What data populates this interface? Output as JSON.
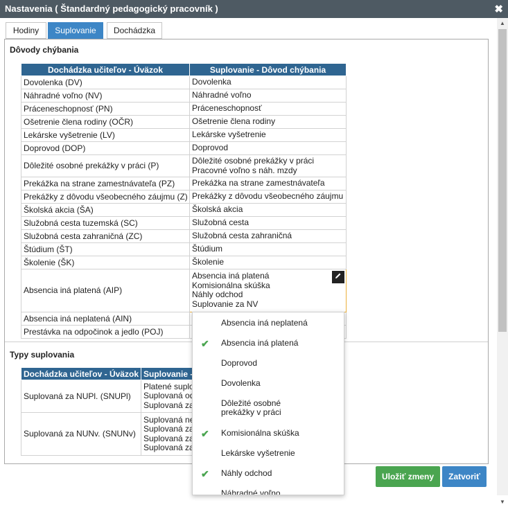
{
  "window": {
    "title": "Nastavenia ( Štandardný pedagogický pracovník )",
    "close_glyph": "✖"
  },
  "tabs": [
    {
      "label": "Hodiny",
      "active": false
    },
    {
      "label": "Suplovanie",
      "active": true
    },
    {
      "label": "Dochádzka",
      "active": false
    }
  ],
  "reasons": {
    "title": "Dôvody chýbania",
    "columns": [
      "Dochádzka učiteľov - Úväzok",
      "Suplovanie - Dôvod chýbania"
    ],
    "rows": [
      {
        "a": "Dovolenka (DV)",
        "b": [
          "Dovolenka"
        ]
      },
      {
        "a": "Náhradné voľno (NV)",
        "b": [
          "Náhradné voľno"
        ]
      },
      {
        "a": "Práceneschopnosť (PN)",
        "b": [
          "Práceneschopnosť"
        ]
      },
      {
        "a": "Ošetrenie člena rodiny (OČR)",
        "b": [
          "Ošetrenie člena rodiny"
        ]
      },
      {
        "a": "Lekárske vyšetrenie (LV)",
        "b": [
          "Lekárske vyšetrenie"
        ]
      },
      {
        "a": "Doprovod (DOP)",
        "b": [
          "Doprovod"
        ]
      },
      {
        "a": "Dôležité osobné prekážky v práci (P)",
        "b": [
          "Dôležité osobné prekážky v práci",
          "Pracovné voľno s náh. mzdy"
        ]
      },
      {
        "a": "Prekážka na strane zamestnávateľa (PZ)",
        "b": [
          "Prekážka na strane zamestnávateľa"
        ]
      },
      {
        "a": "Prekážky z dôvodu všeobecného záujmu (Z)",
        "b": [
          "Prekážky z dôvodu všeobecného záujmu"
        ]
      },
      {
        "a": "Školská akcia (ŠA)",
        "b": [
          "Školská akcia"
        ]
      },
      {
        "a": "Služobná cesta tuzemská (SC)",
        "b": [
          "Služobná cesta"
        ]
      },
      {
        "a": "Služobná cesta zahraničná (ZC)",
        "b": [
          "Služobná cesta zahraničná"
        ]
      },
      {
        "a": "Štúdium (ŠT)",
        "b": [
          "Štúdium"
        ]
      },
      {
        "a": "Školenie (ŠK)",
        "b": [
          "Školenie"
        ]
      },
      {
        "a": "Absencia iná platená (AIP)",
        "b": [
          "Absencia iná platená",
          "Komisionálna skúška",
          "Náhly odchod",
          "Suplovanie za NV"
        ],
        "selected": true
      },
      {
        "a": "Absencia iná neplatená (AIN)",
        "b": []
      },
      {
        "a": "Prestávka na odpočinok a jedlo (POJ)",
        "b": []
      }
    ]
  },
  "edit_icon": "pencil-icon",
  "types": {
    "title": "Typy suplovania",
    "columns": [
      "Dochádzka učiteľov - Úväzok",
      "Suplovanie -"
    ],
    "rows": [
      {
        "a": "Suplovaná za NUPl. (SNUPl)",
        "b": [
          "Platené suplo",
          "Suplovaná od",
          "Suplovaná za"
        ]
      },
      {
        "a": "Suplovaná za NUNv. (SNUNv)",
        "b": [
          "Suplovaná ne",
          "Suplovaná za",
          "Suplovaná za",
          "Suplovaná za"
        ]
      }
    ]
  },
  "dropdown": {
    "options": [
      {
        "label": "Absencia iná neplatená",
        "checked": false
      },
      {
        "label": "Absencia iná platená",
        "checked": true
      },
      {
        "label": "Doprovod",
        "checked": false
      },
      {
        "label": "Dovolenka",
        "checked": false
      },
      {
        "label": "Dôležité osobné\nprekážky v práci",
        "checked": false
      },
      {
        "label": "Komisionálna skúška",
        "checked": true
      },
      {
        "label": "Lekárske vyšetrenie",
        "checked": false
      },
      {
        "label": "Náhly odchod",
        "checked": true
      },
      {
        "label": "Náhradné voľno",
        "checked": false
      }
    ]
  },
  "buttons": {
    "save": "Uložiť zmeny",
    "close": "Zatvoriť"
  },
  "colors": {
    "header": "#2f6591",
    "tab_active": "#3d86c6",
    "save": "#4aa550",
    "close": "#3d86c6",
    "check": "#4aa550"
  }
}
